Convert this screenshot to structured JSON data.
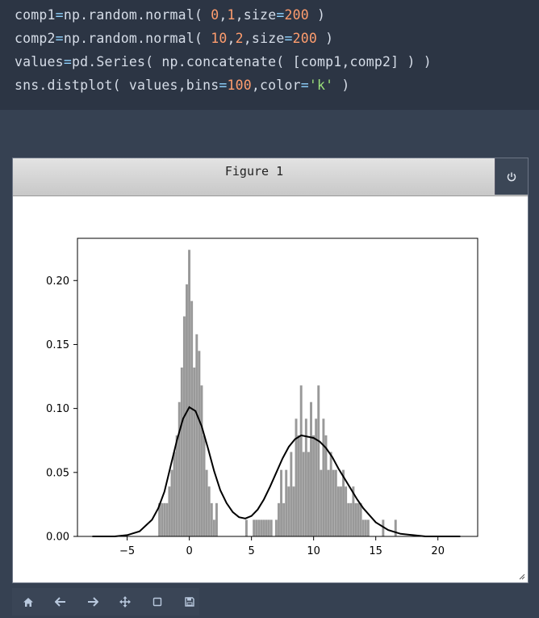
{
  "code": {
    "lines": [
      [
        [
          "comp1",
          "t"
        ],
        [
          "=",
          "op"
        ],
        [
          "np.random.normal( ",
          "t"
        ],
        [
          "0",
          "num"
        ],
        [
          ",",
          "t"
        ],
        [
          "1",
          "num"
        ],
        [
          ",size",
          "t"
        ],
        [
          "=",
          "op"
        ],
        [
          "200",
          "num"
        ],
        [
          " )",
          "t"
        ]
      ],
      [
        [
          "comp2",
          "t"
        ],
        [
          "=",
          "op"
        ],
        [
          "np.random.normal( ",
          "t"
        ],
        [
          "10",
          "num"
        ],
        [
          ",",
          "t"
        ],
        [
          "2",
          "num"
        ],
        [
          ",size",
          "t"
        ],
        [
          "=",
          "op"
        ],
        [
          "200",
          "num"
        ],
        [
          " )",
          "t"
        ]
      ],
      [
        [
          "values",
          "t"
        ],
        [
          "=",
          "op"
        ],
        [
          "pd.Series( np.concatenate( [comp1,comp2] ) )",
          "t"
        ]
      ],
      [
        [
          "sns.distplot( values,bins",
          "t"
        ],
        [
          "=",
          "op"
        ],
        [
          "100",
          "num"
        ],
        [
          ",color",
          "t"
        ],
        [
          "=",
          "op"
        ],
        [
          "'k'",
          "str"
        ],
        [
          " )",
          "t"
        ]
      ]
    ]
  },
  "figure": {
    "title": "Figure 1",
    "power_icon": "power-icon",
    "resize_icon": "resize-grip-icon"
  },
  "toolbar": {
    "buttons": [
      {
        "name": "home-button",
        "icon": "home-icon"
      },
      {
        "name": "back-button",
        "icon": "arrow-left-icon"
      },
      {
        "name": "forward-button",
        "icon": "arrow-right-icon"
      },
      {
        "name": "pan-button",
        "icon": "move-icon"
      },
      {
        "name": "zoom-button",
        "icon": "square-icon"
      },
      {
        "name": "save-button",
        "icon": "floppy-icon"
      }
    ]
  },
  "chart_data": {
    "type": "bar",
    "title": "",
    "xlabel": "",
    "ylabel": "",
    "xlim": [
      -9.0,
      23.2
    ],
    "ylim": [
      0,
      0.233
    ],
    "xticks": [
      -5,
      0,
      5,
      10,
      20,
      15
    ],
    "xtick_labels": [
      "−5",
      "0",
      "5",
      "10",
      "20",
      "15"
    ],
    "yticks": [
      0.0,
      0.05,
      0.1,
      0.15,
      0.2
    ],
    "ytick_labels": [
      "0.00",
      "0.05",
      "0.10",
      "0.15",
      "0.20"
    ],
    "bar_color": "#999999",
    "line_color": "#000000",
    "bin_width": 0.19,
    "histogram": {
      "x": [
        -2.5,
        -2.3,
        -2.1,
        -1.9,
        -1.7,
        -1.5,
        -1.3,
        -1.1,
        -0.9,
        -0.7,
        -0.5,
        -0.3,
        -0.1,
        0.1,
        0.3,
        0.5,
        0.7,
        0.9,
        1.1,
        1.3,
        1.5,
        1.7,
        1.9,
        2.1,
        4.5,
        5.1,
        5.3,
        5.5,
        5.7,
        5.9,
        6.1,
        6.3,
        6.5,
        6.9,
        7.1,
        7.3,
        7.5,
        7.7,
        7.9,
        8.1,
        8.3,
        8.5,
        8.7,
        8.9,
        9.1,
        9.3,
        9.5,
        9.7,
        9.9,
        10.1,
        10.3,
        10.5,
        10.7,
        10.9,
        11.1,
        11.3,
        11.5,
        11.7,
        11.9,
        12.1,
        12.3,
        12.5,
        12.7,
        12.9,
        13.1,
        13.3,
        13.5,
        13.7,
        13.9,
        14.1,
        14.3,
        15.5,
        16.5
      ],
      "values": [
        0.026,
        0.026,
        0.026,
        0.026,
        0.039,
        0.052,
        0.066,
        0.079,
        0.105,
        0.132,
        0.172,
        0.197,
        0.224,
        0.184,
        0.132,
        0.158,
        0.145,
        0.118,
        0.079,
        0.052,
        0.039,
        0.026,
        0.013,
        0.026,
        0.013,
        0.013,
        0.013,
        0.013,
        0.013,
        0.013,
        0.013,
        0.013,
        0.013,
        0.013,
        0.026,
        0.052,
        0.026,
        0.052,
        0.039,
        0.066,
        0.039,
        0.092,
        0.079,
        0.118,
        0.066,
        0.092,
        0.066,
        0.105,
        0.079,
        0.092,
        0.118,
        0.052,
        0.092,
        0.079,
        0.052,
        0.066,
        0.052,
        0.052,
        0.039,
        0.039,
        0.052,
        0.039,
        0.026,
        0.026,
        0.039,
        0.026,
        0.026,
        0.026,
        0.013,
        0.013,
        0.013,
        0.013,
        0.013
      ]
    },
    "kde": {
      "x": [
        -7.8,
        -6,
        -5,
        -4,
        -3,
        -2.5,
        -2,
        -1.5,
        -1,
        -0.5,
        0,
        0.5,
        1,
        1.5,
        2,
        2.5,
        3,
        3.5,
        4,
        4.5,
        5,
        5.5,
        6,
        6.5,
        7,
        7.5,
        8,
        8.5,
        9,
        9.5,
        10,
        10.5,
        11,
        11.5,
        12,
        12.5,
        13,
        13.5,
        14,
        15,
        16,
        17,
        18,
        19,
        20,
        21.8
      ],
      "values": [
        0.0,
        0.0,
        0.001,
        0.004,
        0.013,
        0.022,
        0.035,
        0.055,
        0.075,
        0.092,
        0.101,
        0.098,
        0.086,
        0.069,
        0.051,
        0.036,
        0.026,
        0.019,
        0.015,
        0.014,
        0.016,
        0.021,
        0.029,
        0.039,
        0.05,
        0.061,
        0.07,
        0.076,
        0.079,
        0.078,
        0.077,
        0.074,
        0.069,
        0.062,
        0.053,
        0.045,
        0.037,
        0.029,
        0.022,
        0.011,
        0.005,
        0.002,
        0.001,
        0.0,
        0.0,
        0.0
      ]
    }
  }
}
